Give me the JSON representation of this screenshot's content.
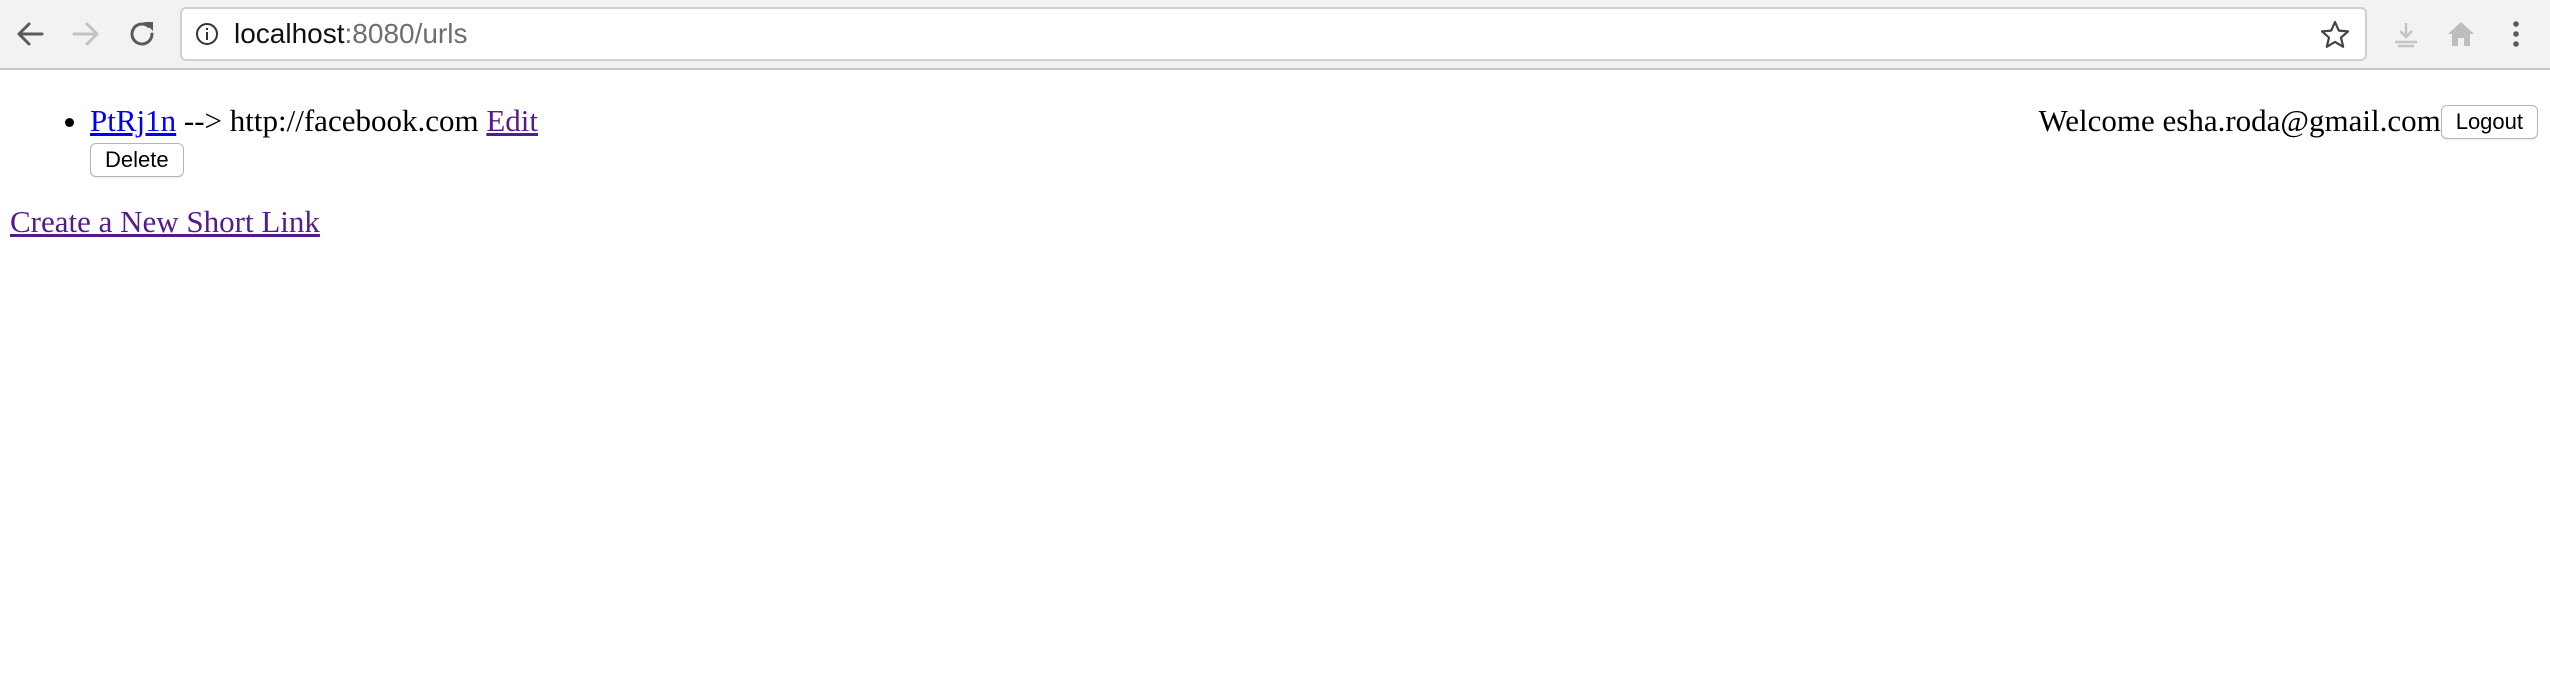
{
  "browser": {
    "address_host": "localhost",
    "address_path": ":8080/urls",
    "icons": {
      "back": "arrow-left-icon",
      "forward": "arrow-right-icon",
      "reload": "reload-icon",
      "info": "info-icon",
      "bookmark": "star-icon",
      "extension": "extension-icon",
      "home": "home-icon",
      "menu": "kebab-menu-icon"
    }
  },
  "header": {
    "welcome_text": "Welcome esha.roda@gmail.com",
    "logout_label": "Logout"
  },
  "urls": [
    {
      "short_code": "PtRj1n",
      "arrow": "-->",
      "long_url": "http://facebook.com",
      "edit_label": "Edit",
      "delete_label": "Delete"
    }
  ],
  "create_link_label": "Create a New Short Link",
  "colors": {
    "link_unvisited": "#0000ee",
    "link_visited": "#551a8b",
    "toolbar_bg": "#f2f2f2"
  }
}
